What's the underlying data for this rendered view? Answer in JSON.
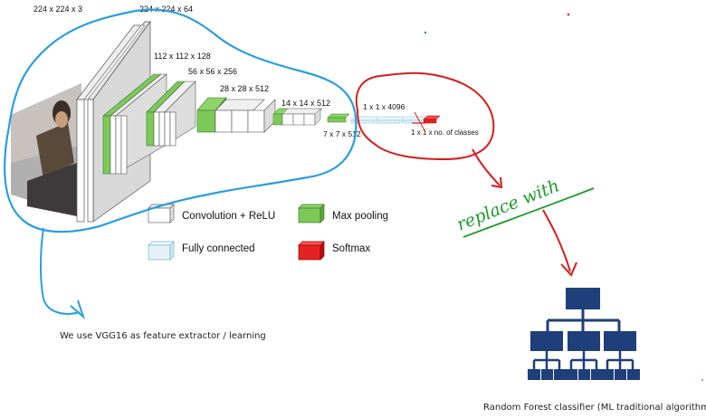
{
  "diagram": {
    "layer_labels": {
      "input": "224 x 224 x 3",
      "conv1": "224 x 224 x 64",
      "conv2": "112 x 112 x 128",
      "conv3": "56 x 56 x 256",
      "conv4": "28 x 28 x 512",
      "conv5": "14 x 14 x 512",
      "pool5": "7 x 7 x 512",
      "fc": "1 x 1 x 4096",
      "softmax": "1 x 1 x no. of classes"
    },
    "legend": {
      "conv": "Convolution + ReLU",
      "pool": "Max pooling",
      "fc": "Fully connected",
      "softmax": "Softmax"
    },
    "annotations": {
      "left_note": "We use VGG16 as feature extractor / learning",
      "replace": "replace with",
      "rf_caption": "Random Forest classifier (ML traditional algorithm)"
    },
    "colors": {
      "conv_face": "#ffffff",
      "conv_side": "#e3e3e3",
      "pool_face": "#7cc95a",
      "pool_side": "#5aa93b",
      "fc_face": "#e4f2f8",
      "softmax": "#e52222",
      "blue_ink": "#2a9ee0",
      "red_ink": "#d81c1c",
      "green_ink": "#1c9a2a",
      "tree_fill": "#1f3f7a"
    }
  }
}
